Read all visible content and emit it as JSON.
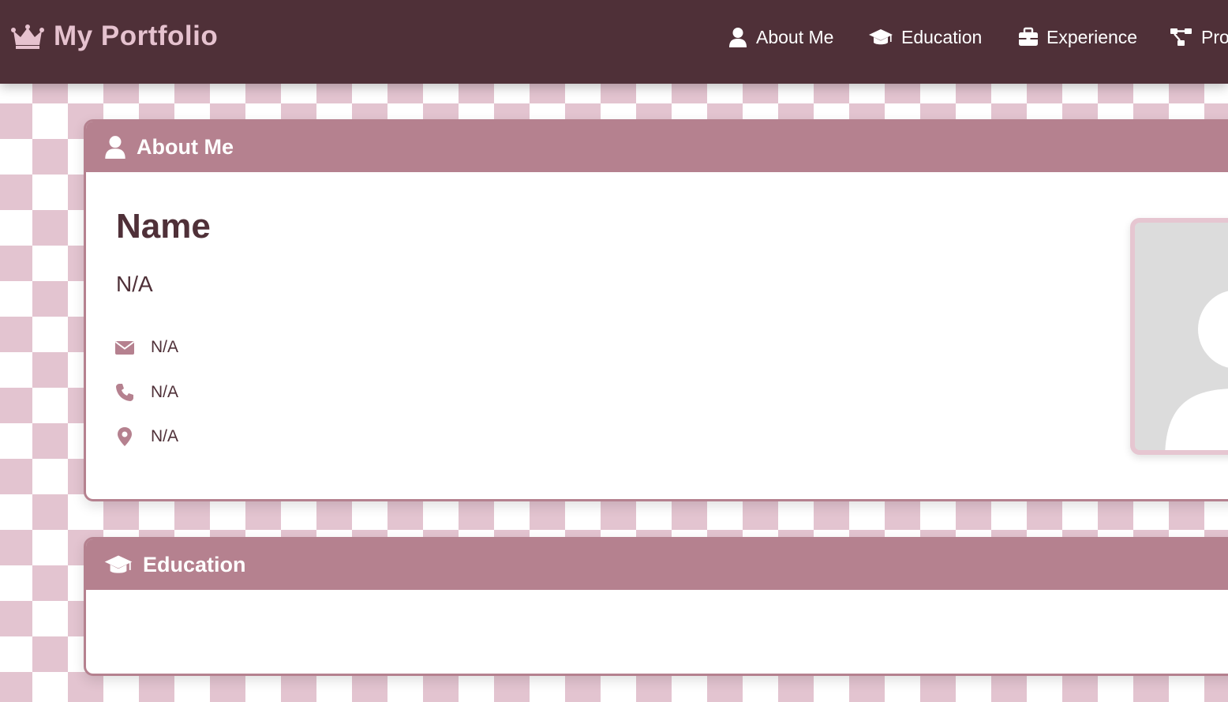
{
  "header": {
    "brand_title": "My Portfolio",
    "brand_icon": "crown-icon",
    "nav": [
      {
        "label": "About Me",
        "icon": "user-icon"
      },
      {
        "label": "Education",
        "icon": "graduation-cap-icon"
      },
      {
        "label": "Experience",
        "icon": "briefcase-icon"
      },
      {
        "label": "Proj",
        "icon": "project-diagram-icon"
      }
    ]
  },
  "about": {
    "title": "About Me",
    "name_heading": "Name",
    "name_value": "N/A",
    "email": "N/A",
    "phone": "N/A",
    "location": "N/A",
    "photo_icon": "avatar-placeholder-icon"
  },
  "education": {
    "title": "Education"
  },
  "colors": {
    "header_bg": "#4f3038",
    "accent": "#b5818f",
    "brand_text": "#e6c2cf",
    "checker": "#e3c4d0"
  }
}
